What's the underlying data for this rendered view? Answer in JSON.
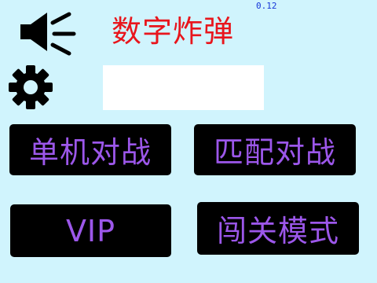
{
  "app": {
    "title": "数字炸弹",
    "version": "0.12"
  },
  "colors": {
    "background": "#d0f4fd",
    "title": "#e8151c",
    "version": "#1535d8",
    "button_bg": "#000000",
    "button_text": "#9c57ea",
    "display_box": "#ffffff"
  },
  "icons": {
    "sound": "speaker-sound-icon",
    "settings": "gear-icon"
  },
  "display": {
    "value": ""
  },
  "menu": {
    "single_player": "单机对战",
    "match": "匹配对战",
    "vip": "VIP",
    "level_mode": "闯关模式"
  }
}
